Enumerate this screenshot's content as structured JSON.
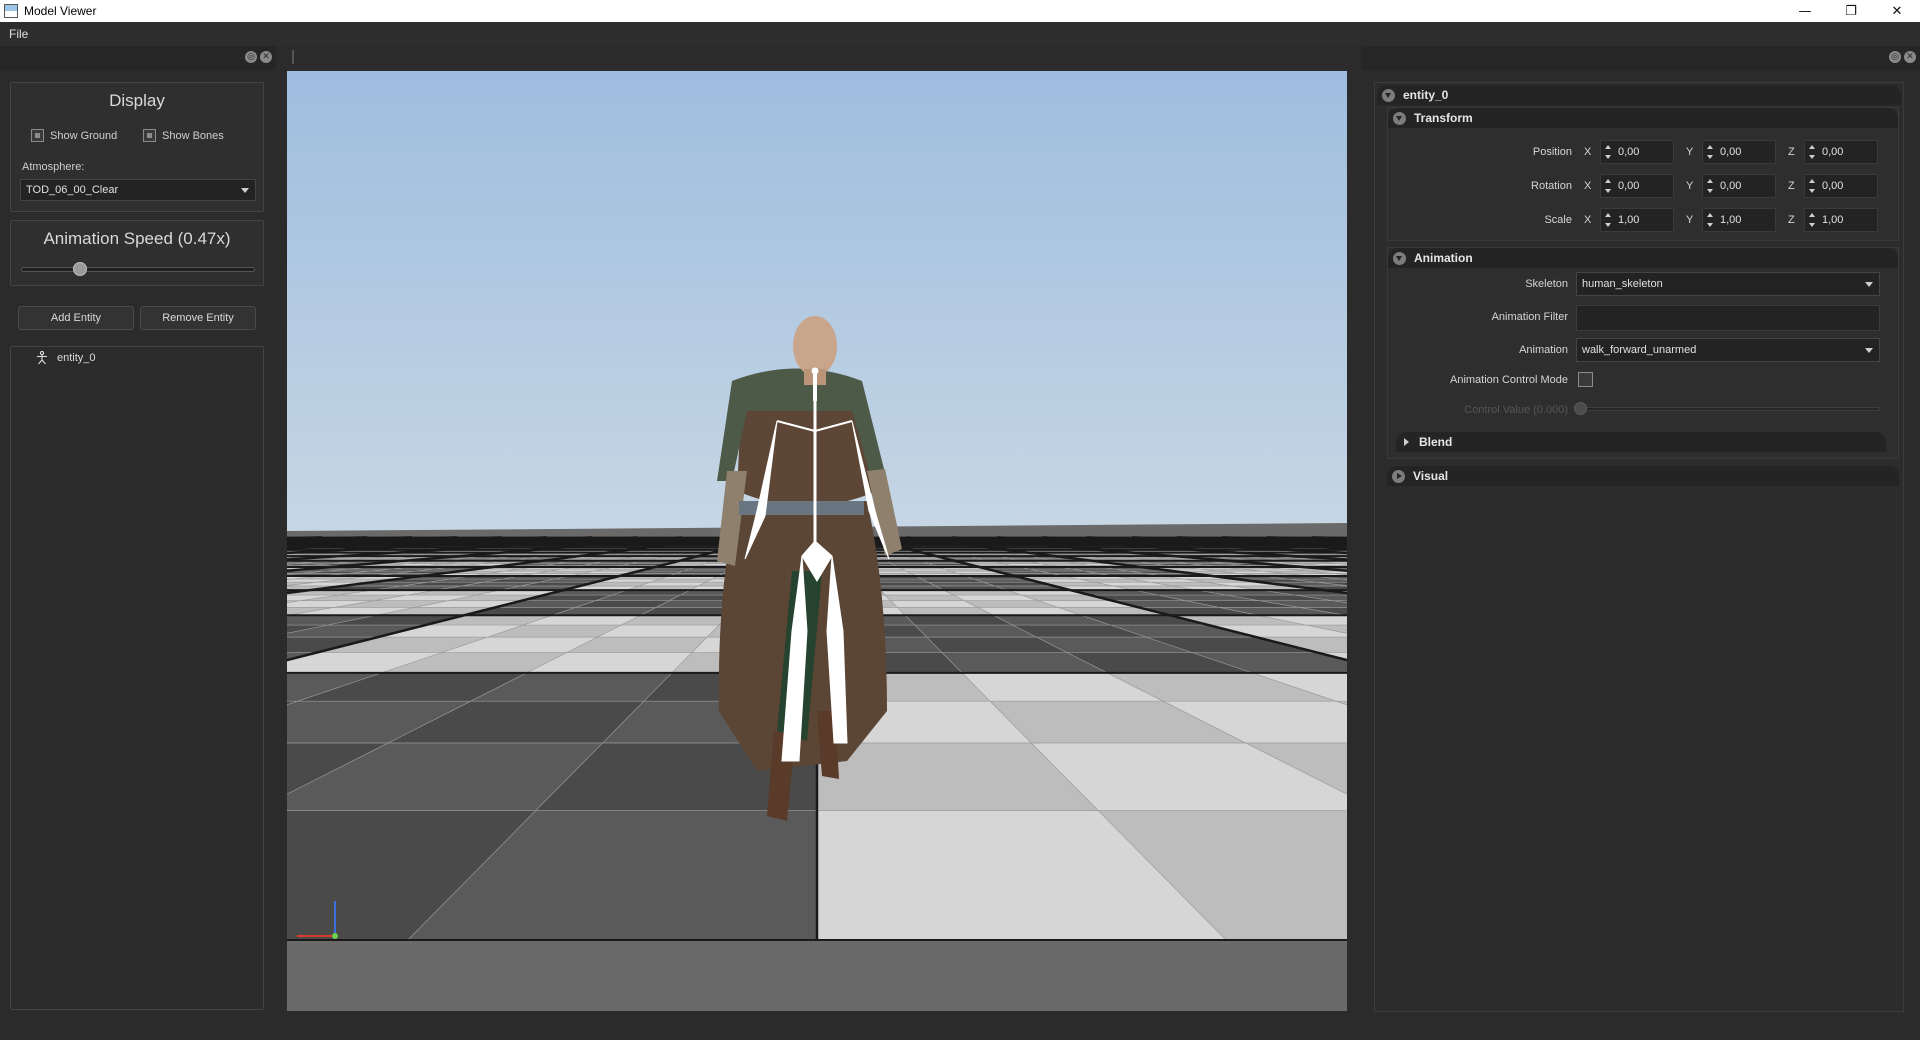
{
  "window": {
    "title": "Model Viewer",
    "controls": {
      "minimize": "—",
      "restore": "❐",
      "close": "✕"
    }
  },
  "menu": {
    "file": "File"
  },
  "dock": {
    "float_icon": "◎",
    "close_icon": "✕"
  },
  "display": {
    "title": "Display",
    "show_ground_label": "Show Ground",
    "show_ground_checked": true,
    "show_bones_label": "Show Bones",
    "show_bones_checked": true,
    "atmosphere_label": "Atmosphere:",
    "atmosphere_value": "TOD_06_00_Clear"
  },
  "animation_speed": {
    "title": "Animation Speed (0.47x)",
    "value": 0.47,
    "slider_fraction": 0.25
  },
  "buttons": {
    "add_entity": "Add Entity",
    "remove_entity": "Remove Entity"
  },
  "entities": [
    {
      "name": "entity_0"
    }
  ],
  "properties": {
    "entity_name": "entity_0",
    "transform": {
      "title": "Transform",
      "rows": [
        {
          "label": "Position",
          "x": "0,00",
          "y": "0,00",
          "z": "0,00"
        },
        {
          "label": "Rotation",
          "x": "0,00",
          "y": "0,00",
          "z": "0,00"
        },
        {
          "label": "Scale",
          "x": "1,00",
          "y": "1,00",
          "z": "1,00"
        }
      ],
      "axis": {
        "x": "X",
        "y": "Y",
        "z": "Z"
      }
    },
    "animation": {
      "title": "Animation",
      "skeleton_label": "Skeleton",
      "skeleton_value": "human_skeleton",
      "filter_label": "Animation Filter",
      "filter_value": "",
      "animation_label": "Animation",
      "animation_value": "walk_forward_unarmed",
      "control_mode_label": "Animation Control Mode",
      "control_mode_checked": false,
      "control_value_label": "Control Value (0.000)",
      "control_value": 0.0
    },
    "blend": {
      "title": "Blend"
    },
    "visual": {
      "title": "Visual"
    }
  },
  "colors": {
    "background": "#2b2b2b",
    "sky_top": "#9ebddf",
    "sky_bottom": "#c5d6e4",
    "tile_light": "#d6d6d6",
    "tile_dark": "#4a4a4a",
    "tile_mid": "#8c8c8c",
    "bones": "#ffffff"
  }
}
